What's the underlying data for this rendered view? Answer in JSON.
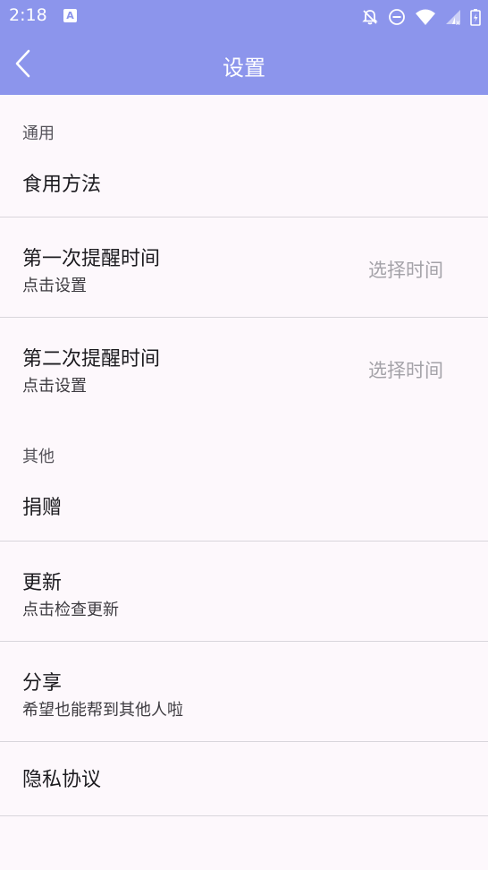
{
  "status_bar": {
    "time": "2:18",
    "a_icon": "A",
    "icons": [
      "notifications-off-icon",
      "do-not-disturb-icon",
      "wifi-icon",
      "signal-icon",
      "battery-charging-icon"
    ]
  },
  "appbar": {
    "title": "设置",
    "back_icon": "back-arrow-icon"
  },
  "colors": {
    "accent": "#8c95ec",
    "background": "#fdf8fc",
    "divider": "#d9d6dc",
    "secondary_text": "#a4a2a8"
  },
  "sections": {
    "general": {
      "header": "通用",
      "usage": {
        "label": "食用方法"
      },
      "first_reminder": {
        "label": "第一次提醒时间",
        "summary": "点击设置",
        "value": "选择时间"
      },
      "second_reminder": {
        "label": "第二次提醒时间",
        "summary": "点击设置",
        "value": "选择时间"
      }
    },
    "other": {
      "header": "其他",
      "donate": {
        "label": "捐赠"
      },
      "update": {
        "label": "更新",
        "summary": "点击检查更新"
      },
      "share": {
        "label": "分享",
        "summary": "希望也能帮到其他人啦"
      },
      "privacy": {
        "label": "隐私协议"
      }
    }
  }
}
